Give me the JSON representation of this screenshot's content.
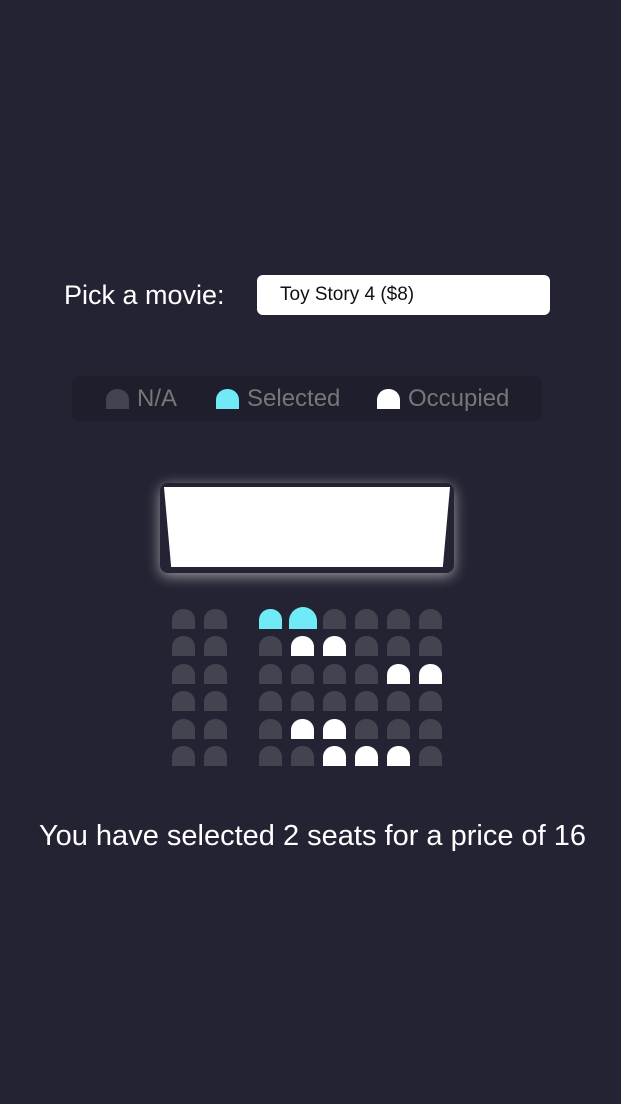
{
  "movie_picker": {
    "label": "Pick a movie:",
    "selected_option": "Toy Story 4 ($8)"
  },
  "legend": {
    "items": [
      {
        "label": "N/A",
        "color": "#444451"
      },
      {
        "label": "Selected",
        "color": "#6feaf6"
      },
      {
        "label": "Occupied",
        "color": "#ffffff"
      }
    ]
  },
  "colors": {
    "background": "#242333",
    "seat_available": "#444451",
    "seat_selected": "#6feaf6",
    "seat_occupied": "#ffffff"
  },
  "seating": {
    "rows": [
      [
        "available",
        "available",
        "selected",
        "selected",
        "available",
        "available",
        "available",
        "available"
      ],
      [
        "available",
        "available",
        "available",
        "occupied",
        "occupied",
        "available",
        "available",
        "available"
      ],
      [
        "available",
        "available",
        "available",
        "available",
        "available",
        "available",
        "occupied",
        "occupied"
      ],
      [
        "available",
        "available",
        "available",
        "available",
        "available",
        "available",
        "available",
        "available"
      ],
      [
        "available",
        "available",
        "available",
        "occupied",
        "occupied",
        "available",
        "available",
        "available"
      ],
      [
        "available",
        "available",
        "available",
        "available",
        "occupied",
        "occupied",
        "occupied",
        "available"
      ]
    ]
  },
  "summary": {
    "prefix": "You have selected",
    "count": "2",
    "middle": "seats for a price of",
    "total": "16"
  }
}
